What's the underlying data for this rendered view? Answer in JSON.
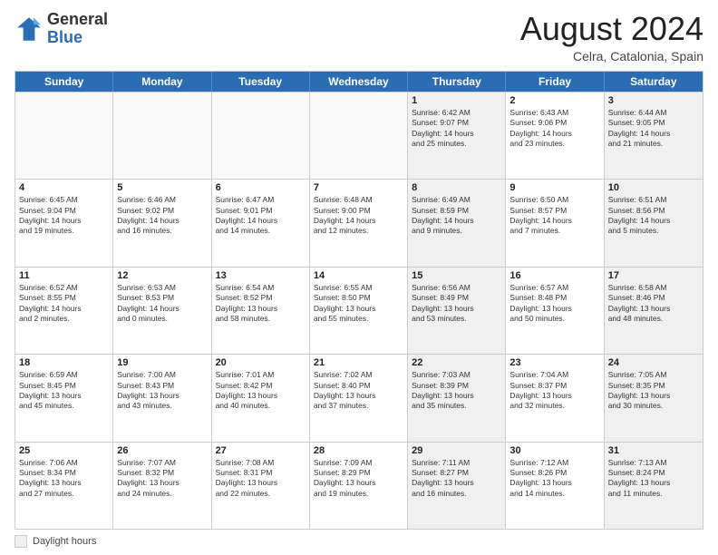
{
  "header": {
    "logo_general": "General",
    "logo_blue": "Blue",
    "month_title": "August 2024",
    "location": "Celra, Catalonia, Spain"
  },
  "footer": {
    "daylight_label": "Daylight hours"
  },
  "weekdays": [
    "Sunday",
    "Monday",
    "Tuesday",
    "Wednesday",
    "Thursday",
    "Friday",
    "Saturday"
  ],
  "rows": [
    [
      {
        "day": "",
        "text": "",
        "shaded": false,
        "empty": true
      },
      {
        "day": "",
        "text": "",
        "shaded": false,
        "empty": true
      },
      {
        "day": "",
        "text": "",
        "shaded": false,
        "empty": true
      },
      {
        "day": "",
        "text": "",
        "shaded": false,
        "empty": true
      },
      {
        "day": "1",
        "text": "Sunrise: 6:42 AM\nSunset: 9:07 PM\nDaylight: 14 hours\nand 25 minutes.",
        "shaded": true,
        "empty": false
      },
      {
        "day": "2",
        "text": "Sunrise: 6:43 AM\nSunset: 9:06 PM\nDaylight: 14 hours\nand 23 minutes.",
        "shaded": false,
        "empty": false
      },
      {
        "day": "3",
        "text": "Sunrise: 6:44 AM\nSunset: 9:05 PM\nDaylight: 14 hours\nand 21 minutes.",
        "shaded": true,
        "empty": false
      }
    ],
    [
      {
        "day": "4",
        "text": "Sunrise: 6:45 AM\nSunset: 9:04 PM\nDaylight: 14 hours\nand 19 minutes.",
        "shaded": false,
        "empty": false
      },
      {
        "day": "5",
        "text": "Sunrise: 6:46 AM\nSunset: 9:02 PM\nDaylight: 14 hours\nand 16 minutes.",
        "shaded": false,
        "empty": false
      },
      {
        "day": "6",
        "text": "Sunrise: 6:47 AM\nSunset: 9:01 PM\nDaylight: 14 hours\nand 14 minutes.",
        "shaded": false,
        "empty": false
      },
      {
        "day": "7",
        "text": "Sunrise: 6:48 AM\nSunset: 9:00 PM\nDaylight: 14 hours\nand 12 minutes.",
        "shaded": false,
        "empty": false
      },
      {
        "day": "8",
        "text": "Sunrise: 6:49 AM\nSunset: 8:59 PM\nDaylight: 14 hours\nand 9 minutes.",
        "shaded": true,
        "empty": false
      },
      {
        "day": "9",
        "text": "Sunrise: 6:50 AM\nSunset: 8:57 PM\nDaylight: 14 hours\nand 7 minutes.",
        "shaded": false,
        "empty": false
      },
      {
        "day": "10",
        "text": "Sunrise: 6:51 AM\nSunset: 8:56 PM\nDaylight: 14 hours\nand 5 minutes.",
        "shaded": true,
        "empty": false
      }
    ],
    [
      {
        "day": "11",
        "text": "Sunrise: 6:52 AM\nSunset: 8:55 PM\nDaylight: 14 hours\nand 2 minutes.",
        "shaded": false,
        "empty": false
      },
      {
        "day": "12",
        "text": "Sunrise: 6:53 AM\nSunset: 8:53 PM\nDaylight: 14 hours\nand 0 minutes.",
        "shaded": false,
        "empty": false
      },
      {
        "day": "13",
        "text": "Sunrise: 6:54 AM\nSunset: 8:52 PM\nDaylight: 13 hours\nand 58 minutes.",
        "shaded": false,
        "empty": false
      },
      {
        "day": "14",
        "text": "Sunrise: 6:55 AM\nSunset: 8:50 PM\nDaylight: 13 hours\nand 55 minutes.",
        "shaded": false,
        "empty": false
      },
      {
        "day": "15",
        "text": "Sunrise: 6:56 AM\nSunset: 8:49 PM\nDaylight: 13 hours\nand 53 minutes.",
        "shaded": true,
        "empty": false
      },
      {
        "day": "16",
        "text": "Sunrise: 6:57 AM\nSunset: 8:48 PM\nDaylight: 13 hours\nand 50 minutes.",
        "shaded": false,
        "empty": false
      },
      {
        "day": "17",
        "text": "Sunrise: 6:58 AM\nSunset: 8:46 PM\nDaylight: 13 hours\nand 48 minutes.",
        "shaded": true,
        "empty": false
      }
    ],
    [
      {
        "day": "18",
        "text": "Sunrise: 6:59 AM\nSunset: 8:45 PM\nDaylight: 13 hours\nand 45 minutes.",
        "shaded": false,
        "empty": false
      },
      {
        "day": "19",
        "text": "Sunrise: 7:00 AM\nSunset: 8:43 PM\nDaylight: 13 hours\nand 43 minutes.",
        "shaded": false,
        "empty": false
      },
      {
        "day": "20",
        "text": "Sunrise: 7:01 AM\nSunset: 8:42 PM\nDaylight: 13 hours\nand 40 minutes.",
        "shaded": false,
        "empty": false
      },
      {
        "day": "21",
        "text": "Sunrise: 7:02 AM\nSunset: 8:40 PM\nDaylight: 13 hours\nand 37 minutes.",
        "shaded": false,
        "empty": false
      },
      {
        "day": "22",
        "text": "Sunrise: 7:03 AM\nSunset: 8:39 PM\nDaylight: 13 hours\nand 35 minutes.",
        "shaded": true,
        "empty": false
      },
      {
        "day": "23",
        "text": "Sunrise: 7:04 AM\nSunset: 8:37 PM\nDaylight: 13 hours\nand 32 minutes.",
        "shaded": false,
        "empty": false
      },
      {
        "day": "24",
        "text": "Sunrise: 7:05 AM\nSunset: 8:35 PM\nDaylight: 13 hours\nand 30 minutes.",
        "shaded": true,
        "empty": false
      }
    ],
    [
      {
        "day": "25",
        "text": "Sunrise: 7:06 AM\nSunset: 8:34 PM\nDaylight: 13 hours\nand 27 minutes.",
        "shaded": false,
        "empty": false
      },
      {
        "day": "26",
        "text": "Sunrise: 7:07 AM\nSunset: 8:32 PM\nDaylight: 13 hours\nand 24 minutes.",
        "shaded": false,
        "empty": false
      },
      {
        "day": "27",
        "text": "Sunrise: 7:08 AM\nSunset: 8:31 PM\nDaylight: 13 hours\nand 22 minutes.",
        "shaded": false,
        "empty": false
      },
      {
        "day": "28",
        "text": "Sunrise: 7:09 AM\nSunset: 8:29 PM\nDaylight: 13 hours\nand 19 minutes.",
        "shaded": false,
        "empty": false
      },
      {
        "day": "29",
        "text": "Sunrise: 7:11 AM\nSunset: 8:27 PM\nDaylight: 13 hours\nand 16 minutes.",
        "shaded": true,
        "empty": false
      },
      {
        "day": "30",
        "text": "Sunrise: 7:12 AM\nSunset: 8:26 PM\nDaylight: 13 hours\nand 14 minutes.",
        "shaded": false,
        "empty": false
      },
      {
        "day": "31",
        "text": "Sunrise: 7:13 AM\nSunset: 8:24 PM\nDaylight: 13 hours\nand 11 minutes.",
        "shaded": true,
        "empty": false
      }
    ]
  ]
}
